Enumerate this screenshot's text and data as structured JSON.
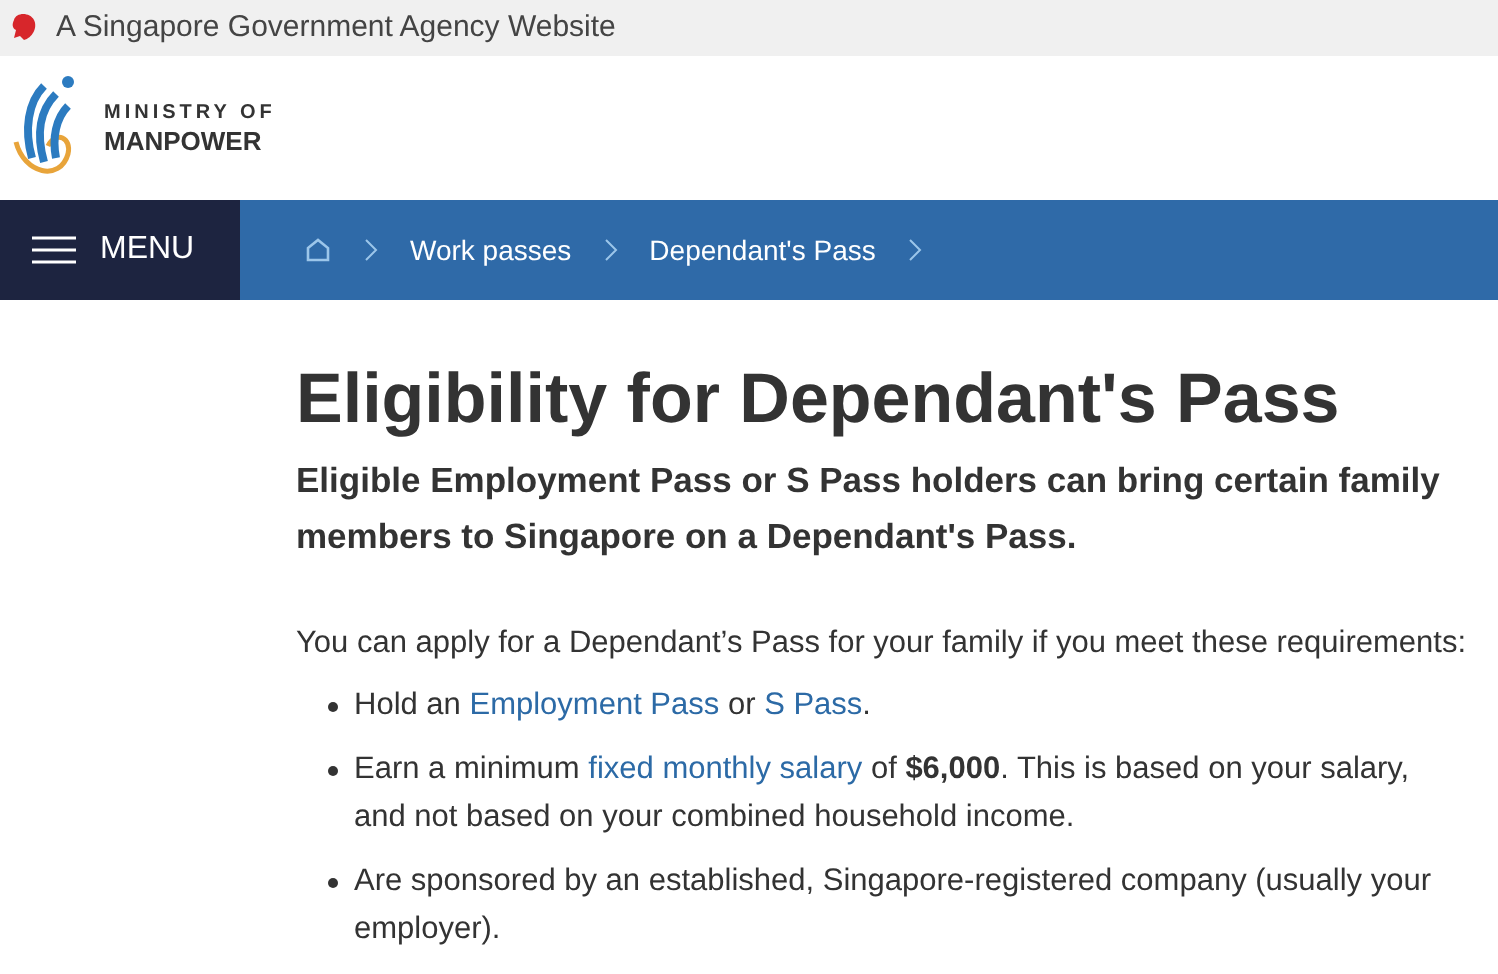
{
  "top_bar": {
    "text": "A Singapore Government Agency Website"
  },
  "logo": {
    "line_1": "MINISTRY OF",
    "line_2": "MANPOWER"
  },
  "nav": {
    "menu_label": "MENU",
    "breadcrumbs": [
      "Work passes",
      "Dependant's Pass"
    ]
  },
  "title": "Eligibility for Dependant's Pass",
  "lead": "Eligible Employment Pass or S Pass holders can bring certain family members to Singapore on a Dependant's Pass.",
  "intro": "You can apply for a Dependant’s Pass for your family if you meet these requirements:",
  "requirements": [
    [
      {
        "kind": "text",
        "text": "Hold an "
      },
      {
        "kind": "link",
        "text": "Employment Pass"
      },
      {
        "kind": "text",
        "text": " or "
      },
      {
        "kind": "link",
        "text": "S Pass"
      },
      {
        "kind": "text",
        "text": "."
      }
    ],
    [
      {
        "kind": "text",
        "text": "Earn a minimum "
      },
      {
        "kind": "link",
        "text": "fixed monthly salary"
      },
      {
        "kind": "text",
        "text": " of "
      },
      {
        "kind": "bold",
        "text": "$6,000"
      },
      {
        "kind": "text",
        "text": ". This is based on your salary, and not based on your combined household income."
      }
    ],
    [
      {
        "kind": "text",
        "text": "Are sponsored by an established, Singapore-registered company (usually your employer)."
      }
    ]
  ]
}
